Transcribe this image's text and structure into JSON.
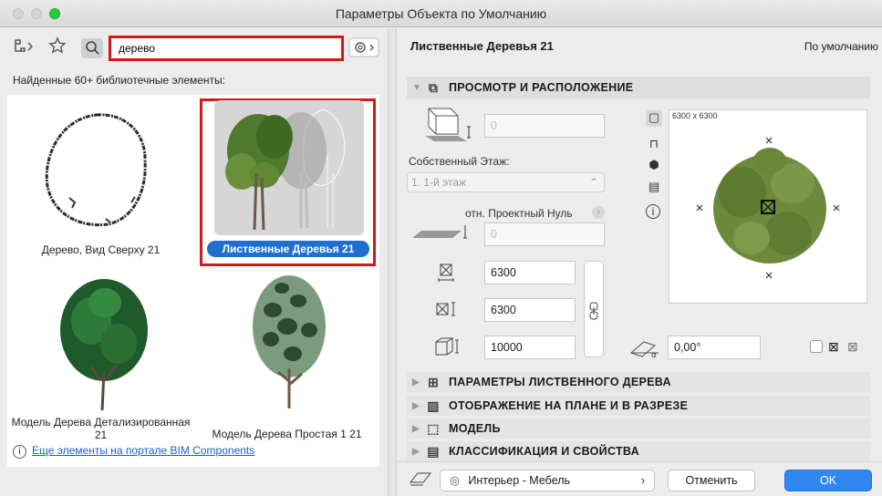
{
  "window": {
    "title": "Параметры Объекта по Умолчанию"
  },
  "left": {
    "search_value": "дерево",
    "found_text": "Найденные 60+ библиотечные элементы:",
    "items": [
      {
        "label": "Дерево, Вид Сверху 21"
      },
      {
        "label": "Лиственные Деревья 21"
      },
      {
        "label": "Модель Дерева Детализированная 21"
      },
      {
        "label": "Модель Дерева Простая 1 21"
      }
    ],
    "more_link": "Еще элементы на портале BIM Components",
    "info_glyph": "i"
  },
  "right": {
    "object_name": "Лиственные Деревья 21",
    "default_label": "По умолчанию",
    "section_view": "ПРОСМОТР И РАСПОЛОЖЕНИЕ",
    "offset_value": "0",
    "home_story_label": "Собственный Этаж:",
    "home_story_value": "1. 1-й этаж",
    "ref_label": "отн. Проектный Нуль",
    "ref_value": "0",
    "width_value": "6300",
    "depth_value": "6300",
    "height_value": "10000",
    "angle_value": "0,00°",
    "preview_label": "6300 x 6300",
    "sections": [
      "ПАРАМЕТРЫ ЛИСТВЕННОГО ДЕРЕВА",
      "ОТОБРАЖЕНИЕ НА ПЛАНЕ И В РАЗРЕЗЕ",
      "МОДЕЛЬ",
      "КЛАССИФИКАЦИЯ И СВОЙСТВА"
    ],
    "layer_value": "Интерьер - Мебель",
    "cancel_label": "Отменить",
    "ok_label": "OK"
  },
  "colors": {
    "accent": "#2f87f0",
    "highlight": "#d11a1a",
    "selection": "#1f6fcf"
  }
}
